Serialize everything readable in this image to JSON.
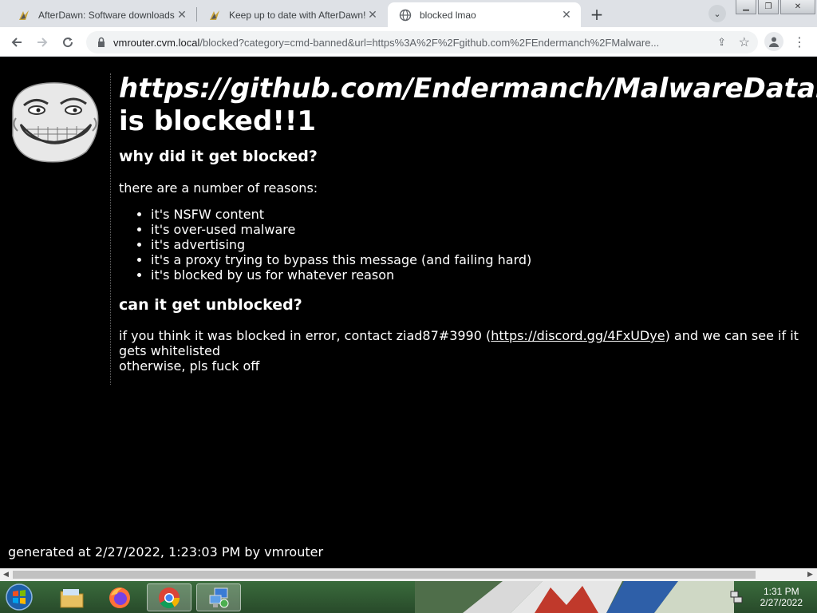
{
  "browser": {
    "tabs": [
      {
        "title": "AfterDawn: Software downloads",
        "active": false
      },
      {
        "title": "Keep up to date with AfterDawn!",
        "active": false
      },
      {
        "title": "blocked lmao",
        "active": true
      }
    ],
    "address": {
      "host": "vmrouter.cvm.local",
      "rest": "/blocked?category=cmd-banned&url=https%3A%2F%2Fgithub.com%2FEndermanch%2FMalware..."
    }
  },
  "page": {
    "headline_url": "https://github.com/Endermanch/MalwareDatabase",
    "headline_blocked": "is blocked!!1",
    "why_heading": "why did it get blocked?",
    "reasons_intro": "there are a number of reasons:",
    "reasons": [
      "it's NSFW content",
      "it's over-used malware",
      "it's advertising",
      "it's a proxy trying to bypass this message (and failing hard)",
      "it's blocked by us for whatever reason"
    ],
    "unblock_heading": "can it get unblocked?",
    "contact_prefix": "if you think it was blocked in error, contact ziad87#3990 (",
    "contact_link": "https://discord.gg/4FxUDye",
    "contact_suffix": ") and we can see if it gets whitelisted",
    "otherwise": "otherwise, pls fuck off",
    "footer": "generated at 2/27/2022, 1:23:03 PM by vmrouter"
  },
  "taskbar": {
    "items": [
      "start-orb",
      "file-explorer",
      "firefox",
      "chrome",
      "network-app"
    ],
    "clock_time": "1:31 PM",
    "clock_date": "2/27/2022"
  },
  "colors": {
    "page_bg": "#000000",
    "text": "#ffffff",
    "tabstrip_bg": "#dee1e6",
    "omnibox_bg": "#f1f3f4"
  }
}
